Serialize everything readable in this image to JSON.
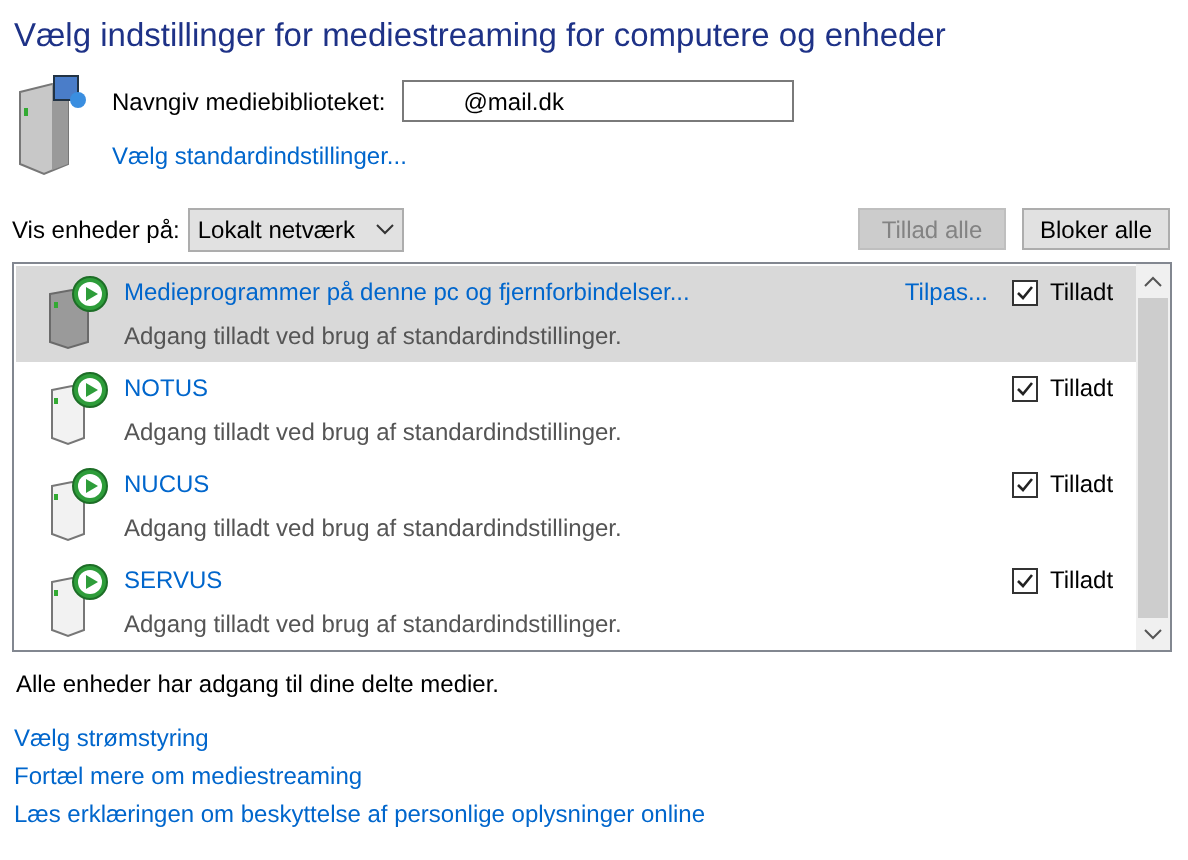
{
  "title": "Vælg indstillinger for mediestreaming for computere og enheder",
  "library": {
    "label": "Navngiv mediebiblioteket:",
    "value": "@mail.dk",
    "defaults_link": "Vælg standardindstillinger..."
  },
  "filter": {
    "label": "Vis enheder på:",
    "value": "Lokalt netværk"
  },
  "buttons": [
    {
      "label": "Tillad alle",
      "disabled": true
    },
    {
      "label": "Bloker alle",
      "disabled": false
    }
  ],
  "devices": [
    {
      "kind": "program",
      "name": "Medieprogrammer på denne pc og fjernforbindelser...",
      "status": "Adgang tilladt ved brug af standardindstillinger.",
      "customize": "Tilpas...",
      "allowed_label": "Tilladt",
      "checked": true,
      "selected": true
    },
    {
      "kind": "device",
      "name": "NOTUS",
      "status": "Adgang tilladt ved brug af standardindstillinger.",
      "allowed_label": "Tilladt",
      "checked": true,
      "selected": false
    },
    {
      "kind": "device",
      "name": "NUCUS",
      "status": "Adgang tilladt ved brug af standardindstillinger.",
      "allowed_label": "Tilladt",
      "checked": true,
      "selected": false
    },
    {
      "kind": "device",
      "name": "SERVUS",
      "status": "Adgang tilladt ved brug af standardindstillinger.",
      "allowed_label": "Tilladt",
      "checked": true,
      "selected": false
    }
  ],
  "summary": "Alle enheder har adgang til dine delte medier.",
  "links": [
    "Vælg strømstyring",
    "Fortæl mere om mediestreaming",
    "Læs erklæringen om beskyttelse af personlige oplysninger online"
  ]
}
